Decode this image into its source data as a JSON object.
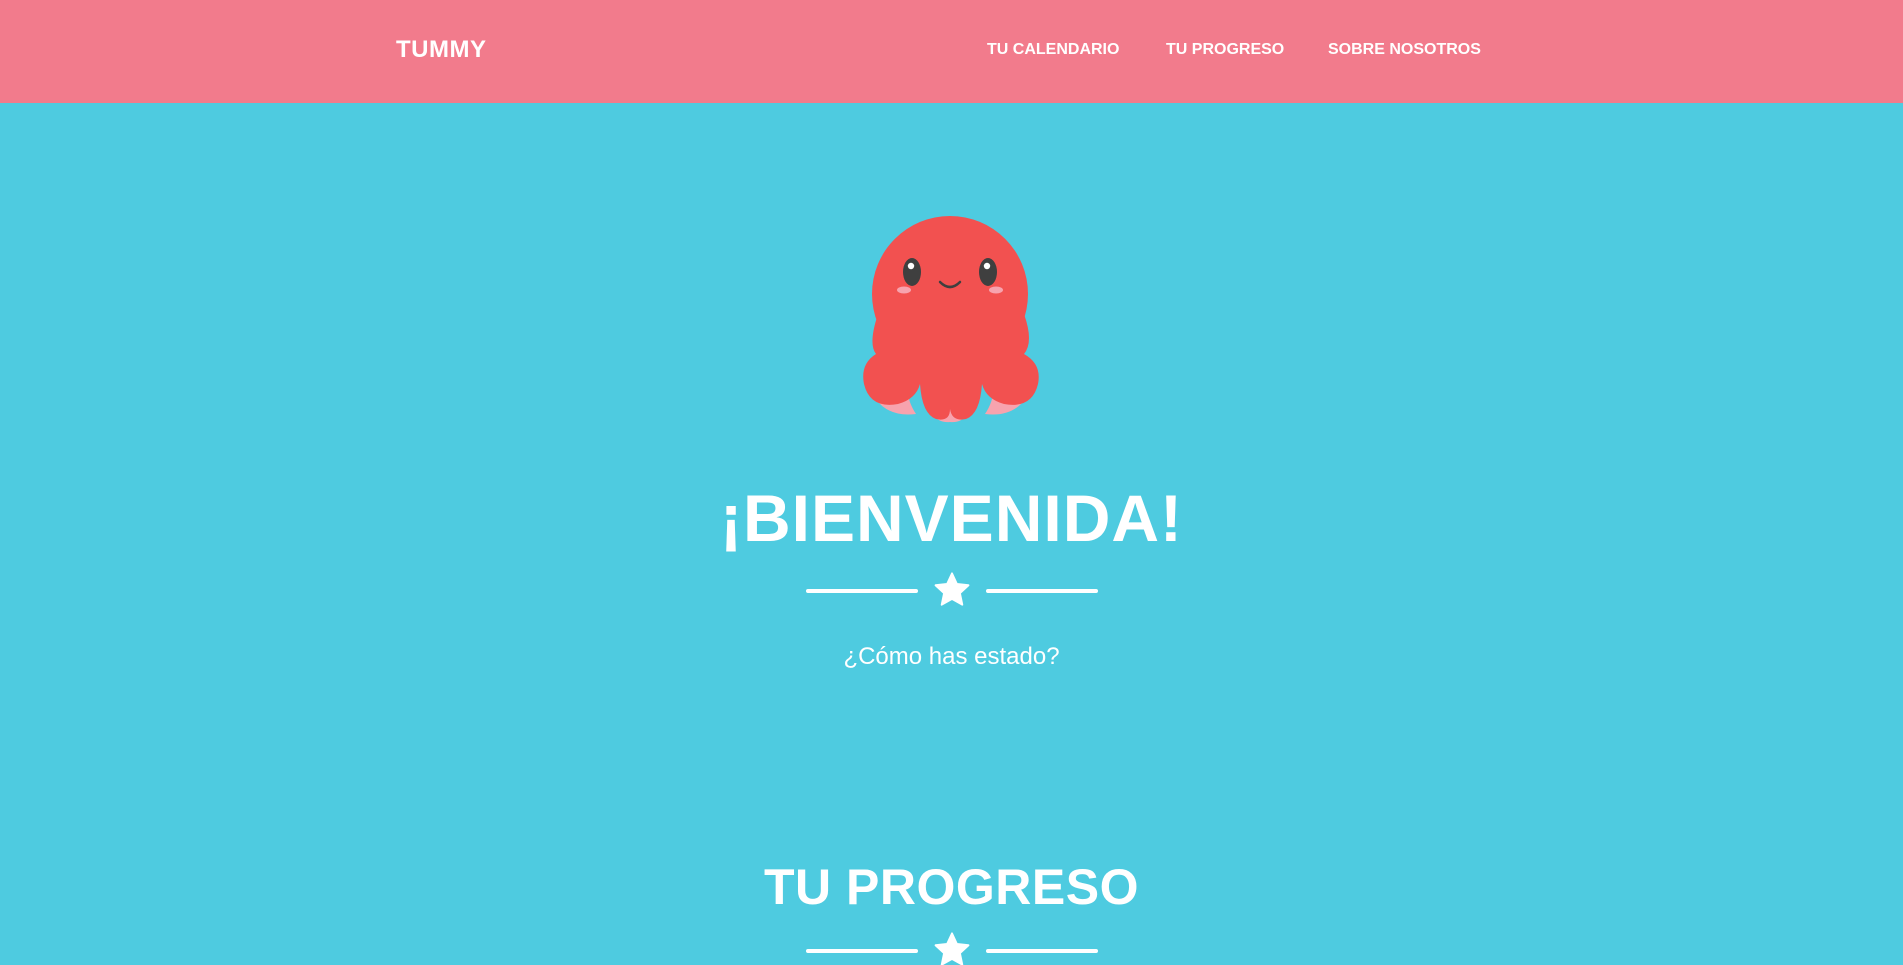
{
  "navbar": {
    "brand": "TUMMY",
    "links": [
      "TU CALENDARIO",
      "TU PROGRESO",
      "SOBRE NOSOTROS"
    ],
    "background": "#f27b8c"
  },
  "hero": {
    "mascot_icon": "octopus-icon",
    "title": "¡BIENVENIDA!",
    "divider_icon": "star-icon",
    "subtitle": "¿Cómo has estado?"
  },
  "progress_section": {
    "title": "TU PROGRESO",
    "divider_icon": "star-icon"
  },
  "colors": {
    "page_background": "#4ecbe0",
    "accent_pink": "#f27b8c",
    "octopus_red": "#f25150",
    "text": "#ffffff"
  }
}
